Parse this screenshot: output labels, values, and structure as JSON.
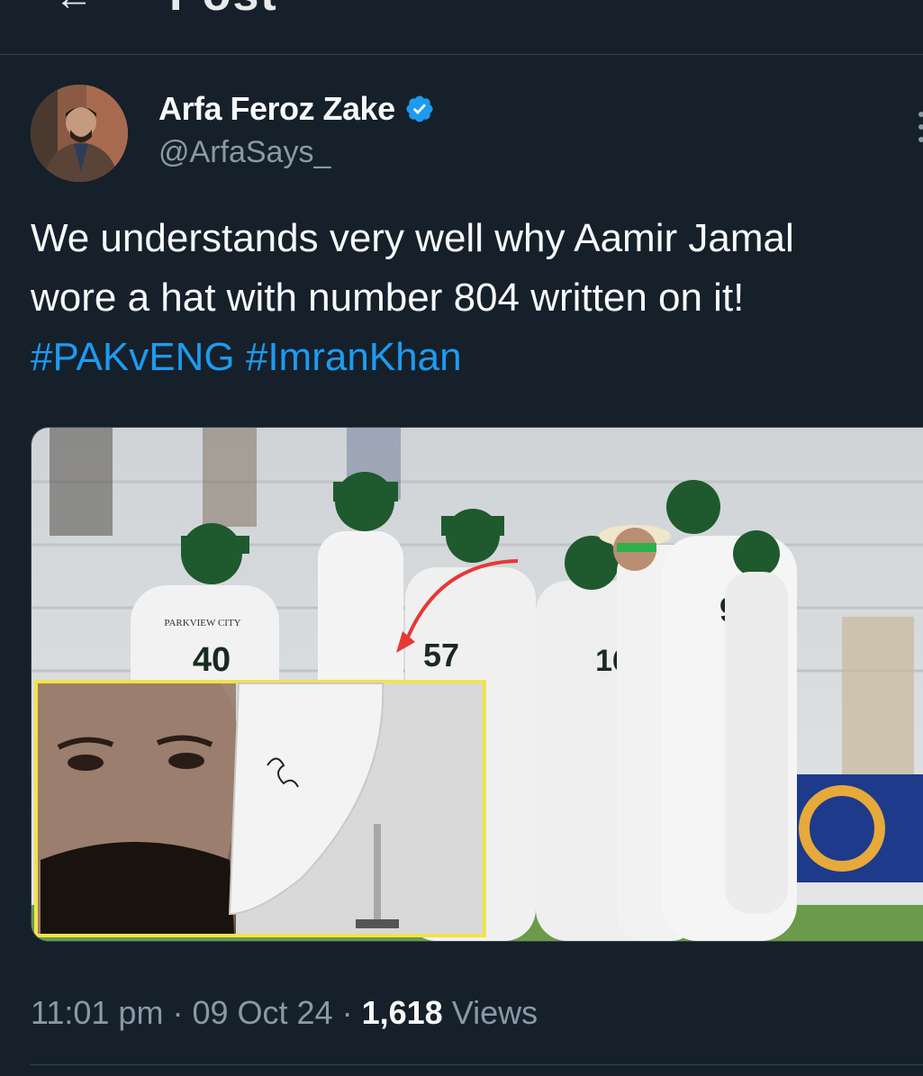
{
  "header": {
    "title": "Post",
    "back_icon": "arrow-left-icon"
  },
  "author": {
    "name": "Arfa Feroz Zake",
    "handle": "@ArfaSays_",
    "verified": true,
    "verified_color": "#1d9bf0"
  },
  "tweet": {
    "text_line1": "We understands very well why Aamir Jamal",
    "text_line2": "wore a hat with number 804 written on it!",
    "hashtags": [
      "#PAKvENG",
      "#ImranKhan"
    ]
  },
  "media": {
    "jersey_numbers": [
      "40",
      "57",
      "16",
      "94"
    ],
    "sponsor_text": "PARKVIEW CITY"
  },
  "meta": {
    "time": "11:01 pm",
    "separator": "·",
    "date": "09 Oct 24",
    "views_count": "1,618",
    "views_label": "Views"
  },
  "colors": {
    "background": "#15202b",
    "text_primary": "#f7f9f9",
    "text_secondary": "#8b98a5",
    "link": "#1d9bf0",
    "border": "#38444d"
  }
}
